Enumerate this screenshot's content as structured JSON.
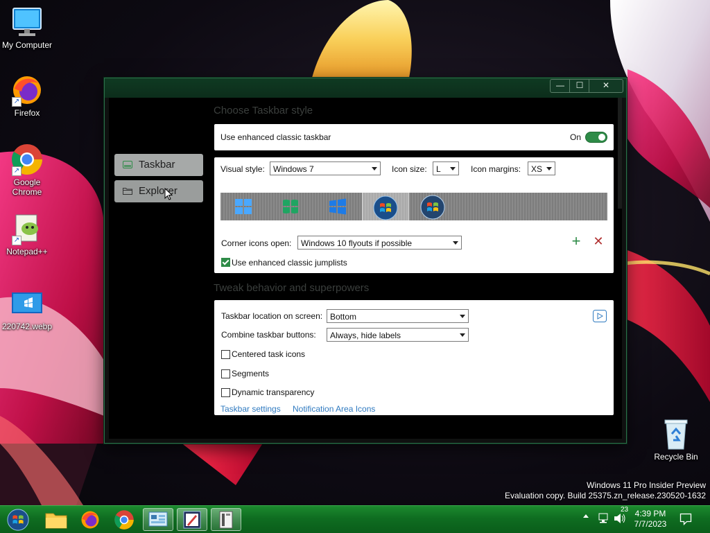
{
  "desktop": {
    "icons": [
      {
        "label": "My Computer"
      },
      {
        "label": "Firefox"
      },
      {
        "label": "Google Chrome"
      },
      {
        "label": "Notepad++"
      },
      {
        "label": "220742.webp"
      },
      {
        "label": "Recycle Bin"
      }
    ],
    "watermark": {
      "line1": "Windows 11 Pro Insider Preview",
      "line2": "Evaluation copy. Build 25375.zn_release.230520-1632"
    }
  },
  "window": {
    "controls": {
      "minimize": "—",
      "maximize": "☐",
      "close": "✕"
    },
    "nav": {
      "taskbar": "Taskbar",
      "explorer": "Explorer"
    },
    "section1": {
      "title": "Choose Taskbar style",
      "enhanced_label": "Use enhanced classic taskbar",
      "enhanced_state": "On",
      "visual_style_label": "Visual style:",
      "visual_style_value": "Windows 7",
      "icon_size_label": "Icon size:",
      "icon_size_value": "L",
      "icon_margins_label": "Icon margins:",
      "icon_margins_value": "XS",
      "corner_label": "Corner icons open:",
      "corner_value": "Windows 10 flyouts if possible",
      "add_icon": "+",
      "remove_icon": "✕",
      "jumplists_label": "Use enhanced classic jumplists"
    },
    "section2": {
      "title": "Tweak behavior and superpowers",
      "location_label": "Taskbar location on screen:",
      "location_value": "Bottom",
      "combine_label": "Combine taskbar buttons:",
      "combine_value": "Always, hide labels",
      "centered_label": "Centered task icons",
      "segments_label": "Segments",
      "dynamic_label": "Dynamic transparency",
      "link_taskbar": "Taskbar settings",
      "link_notif": "Notification Area Icons"
    }
  },
  "taskbar": {
    "tray_badge": "23",
    "time": "4:39 PM",
    "date": "7/7/2023"
  },
  "colors": {
    "accent": "#2e8b47",
    "taskbar": "#0f6d21",
    "link": "#2f7ac0"
  }
}
